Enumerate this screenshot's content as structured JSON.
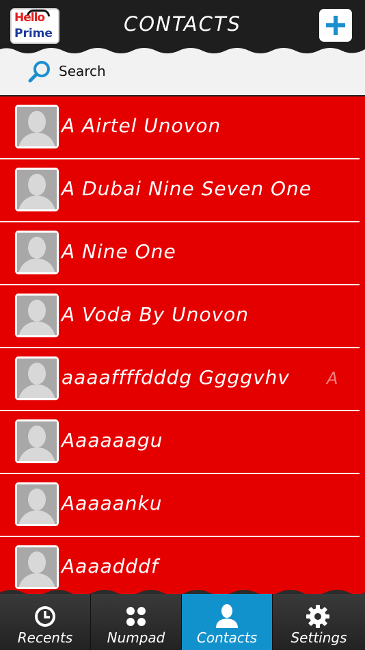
{
  "header": {
    "logo_top": "Hello",
    "logo_bottom": "Prime",
    "title": "CONTACTS",
    "add_icon": "plus-icon"
  },
  "search": {
    "placeholder": "Search",
    "icon": "search-icon"
  },
  "contacts": [
    {
      "name": "A Airtel Unovon"
    },
    {
      "name": "A Dubai Nine Seven One"
    },
    {
      "name": "A Nine One"
    },
    {
      "name": "A Voda By Unovon"
    },
    {
      "name": "aaaaffffdddg Ggggvhv",
      "ghost": "A"
    },
    {
      "name": "Aaaaaagu"
    },
    {
      "name": "Aaaaanku"
    },
    {
      "name": "Aaaadddf"
    }
  ],
  "tabs": [
    {
      "label": "Recents",
      "icon": "clock-icon",
      "active": false
    },
    {
      "label": "Numpad",
      "icon": "dots-icon",
      "active": false
    },
    {
      "label": "Contacts",
      "icon": "person-icon",
      "active": true
    },
    {
      "label": "Settings",
      "icon": "gear-icon",
      "active": false
    }
  ],
  "colors": {
    "row_background": "#e50000",
    "header_background": "#1e1e1e",
    "active_tab": "#1292cc",
    "accent": "#1a8fd0"
  }
}
